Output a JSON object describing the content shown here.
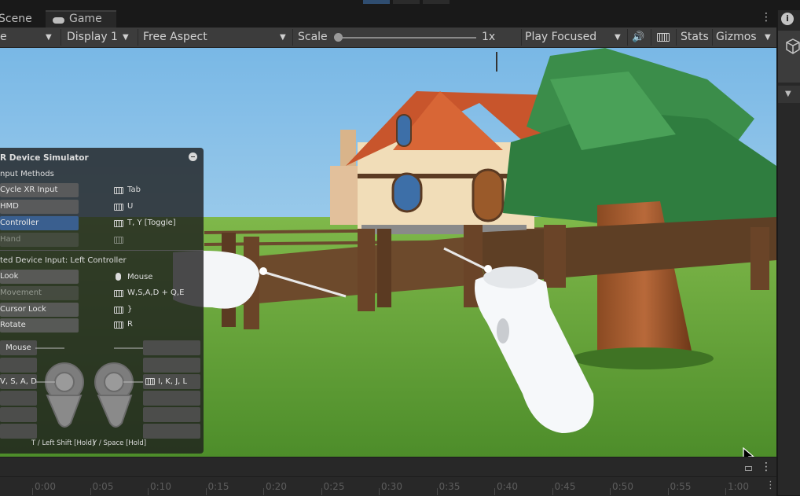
{
  "tabs": {
    "scene": "Scene",
    "game": "Game"
  },
  "toolbar": {
    "camera_fragment": "e",
    "display": "Display 1",
    "aspect": "Free Aspect",
    "scale_label": "Scale",
    "scale_value": "1x",
    "play_mode": "Play Focused",
    "stats": "Stats",
    "gizmos": "Gizmos"
  },
  "simulator": {
    "title": "R Device Simulator",
    "input_methods_label": "nput Methods",
    "methods": [
      {
        "label": "Cycle XR Input",
        "key": "Tab"
      },
      {
        "label": "HMD",
        "key": "U"
      },
      {
        "label": "Controller",
        "key": "T, Y [Toggle]"
      },
      {
        "label": "Hand",
        "key": ""
      }
    ],
    "device_input_label": "ted Device Input:  Left Controller",
    "actions": [
      {
        "label": "Look",
        "key": "Mouse"
      },
      {
        "label": "Movement",
        "key": "W,S,A,D + Q,E"
      },
      {
        "label": "Cursor Lock",
        "key": "}"
      },
      {
        "label": "Rotate",
        "key": "R"
      }
    ],
    "left_bindings": [
      "Mouse",
      "",
      "V, S, A, D",
      "",
      ""
    ],
    "right_bindings": [
      "",
      "",
      "I, K, J, L",
      "",
      "",
      ""
    ],
    "footer_left": "T / Left Shift [Hold]",
    "footer_right": "Y / Space [Hold]"
  },
  "timeline": {
    "labels": [
      "0:00",
      "0:05",
      "0:10",
      "0:15",
      "0:20",
      "0:25",
      "0:30",
      "0:35",
      "0:40",
      "0:45",
      "0:50",
      "0:55",
      "1:00"
    ]
  },
  "colors": {
    "accent_selected": "#3a5f8f",
    "sky": "#8ec6e8",
    "grass": "#5a9a32"
  }
}
